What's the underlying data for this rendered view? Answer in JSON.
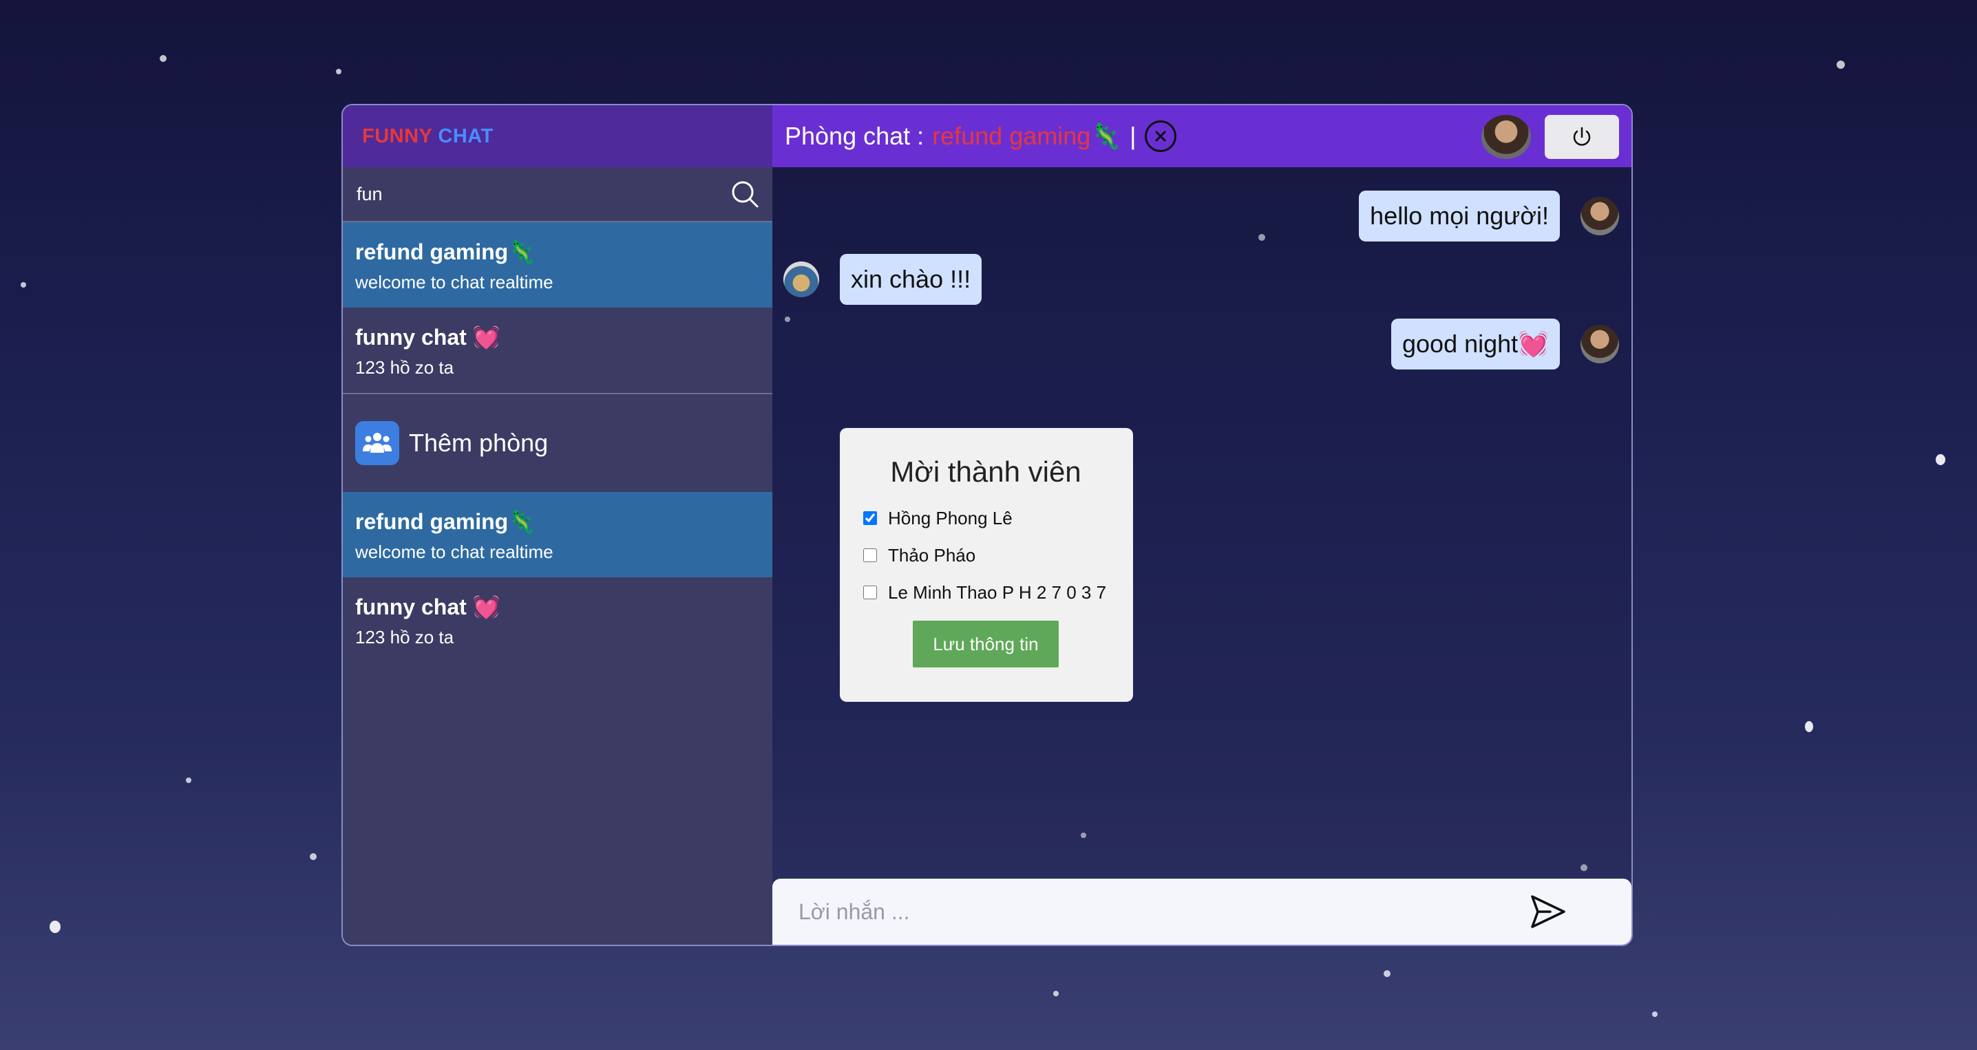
{
  "brand": {
    "funny": "FUNNY",
    "chat": "CHAT"
  },
  "search": {
    "value": "fun",
    "placeholder": ""
  },
  "rooms_top": [
    {
      "name": "refund gaming🦎",
      "sub": "welcome to chat realtime",
      "active": true
    },
    {
      "name": "funny chat 💓",
      "sub": "123 hồ zo ta",
      "active": false
    }
  ],
  "add_room_label": "Thêm phòng",
  "rooms_bottom": [
    {
      "name": "refund gaming🦎",
      "sub": "welcome to chat realtime",
      "active": true
    },
    {
      "name": "funny chat 💓",
      "sub": "123 hồ zo ta",
      "active": false
    }
  ],
  "topbar": {
    "prefix": "Phòng chat :",
    "room_name": "refund gaming🦎",
    "separator": "|"
  },
  "messages": [
    {
      "text": "hello mọi người!",
      "mine": true
    },
    {
      "text": "xin chào !!!",
      "mine": false
    },
    {
      "text": "good night💓",
      "mine": true
    }
  ],
  "invite_modal": {
    "title": "Mời thành viên",
    "members": [
      {
        "name": "Hồng Phong Lê",
        "checked": true
      },
      {
        "name": "Thảo Pháo",
        "checked": false
      },
      {
        "name": "Le Minh Thao P H 2 7 0 3 7",
        "checked": false
      }
    ],
    "save_label": "Lưu thông tin"
  },
  "composer": {
    "placeholder": "Lời nhắn ..."
  },
  "colors": {
    "brand_red": "#e5383b",
    "brand_blue": "#4a8dff",
    "topbar": "#6a2fd3",
    "active_room": "#2e6aa1",
    "save_button": "#5fa859"
  },
  "icons": {
    "search": "search-icon",
    "close": "close-circle-icon",
    "power": "power-icon",
    "send": "send-icon",
    "add_room": "group-add-icon"
  }
}
